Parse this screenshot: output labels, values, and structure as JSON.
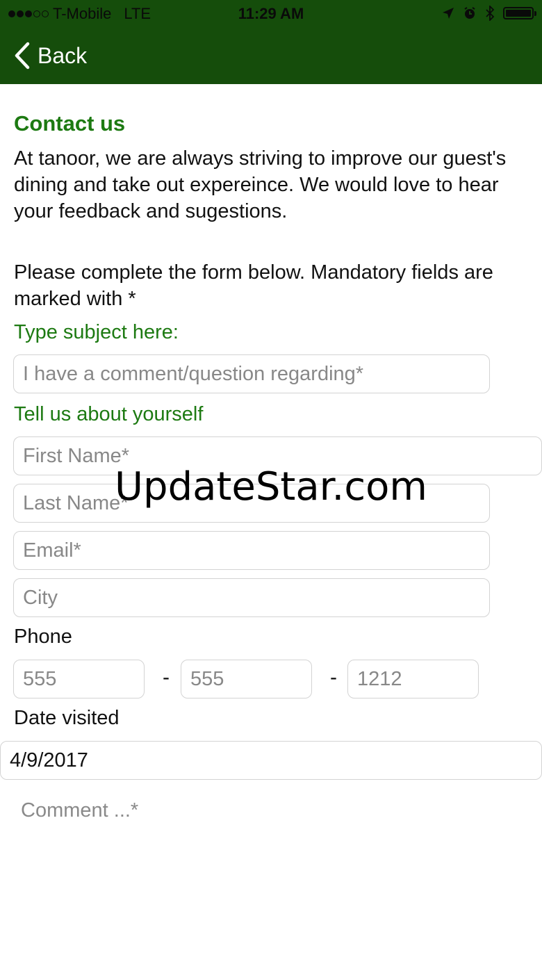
{
  "status_bar": {
    "carrier": "T-Mobile",
    "network": "LTE",
    "time": "11:29 AM",
    "signal_filled": 3,
    "signal_total": 5
  },
  "nav": {
    "back_label": "Back",
    "bar_color": "#154d0b"
  },
  "intro": {
    "title": "Contact us",
    "text": "At tanoor, we are always striving to improve our guest's dining and take out expereince. We would love to hear your feedback and sugestions.",
    "instructions": "Please complete the form below. Mandatory fields are marked with *"
  },
  "form": {
    "subject_label": "Type subject here:",
    "subject_placeholder": "I have a comment/question regarding*",
    "about_label": "Tell us about yourself",
    "first_name_placeholder": "First Name*",
    "last_name_placeholder": "Last Name*",
    "email_placeholder": "Email*",
    "city_placeholder": "City",
    "phone_label": "Phone",
    "phone_area_placeholder": "555",
    "phone_prefix_placeholder": "555",
    "phone_line_placeholder": "1212",
    "phone_separator": "-",
    "date_label": "Date visited",
    "date_value": "4/9/2017",
    "comment_placeholder": "Comment ...*"
  },
  "watermark": "UpdateStar.com",
  "colors": {
    "accent_green": "#1d7a12"
  }
}
